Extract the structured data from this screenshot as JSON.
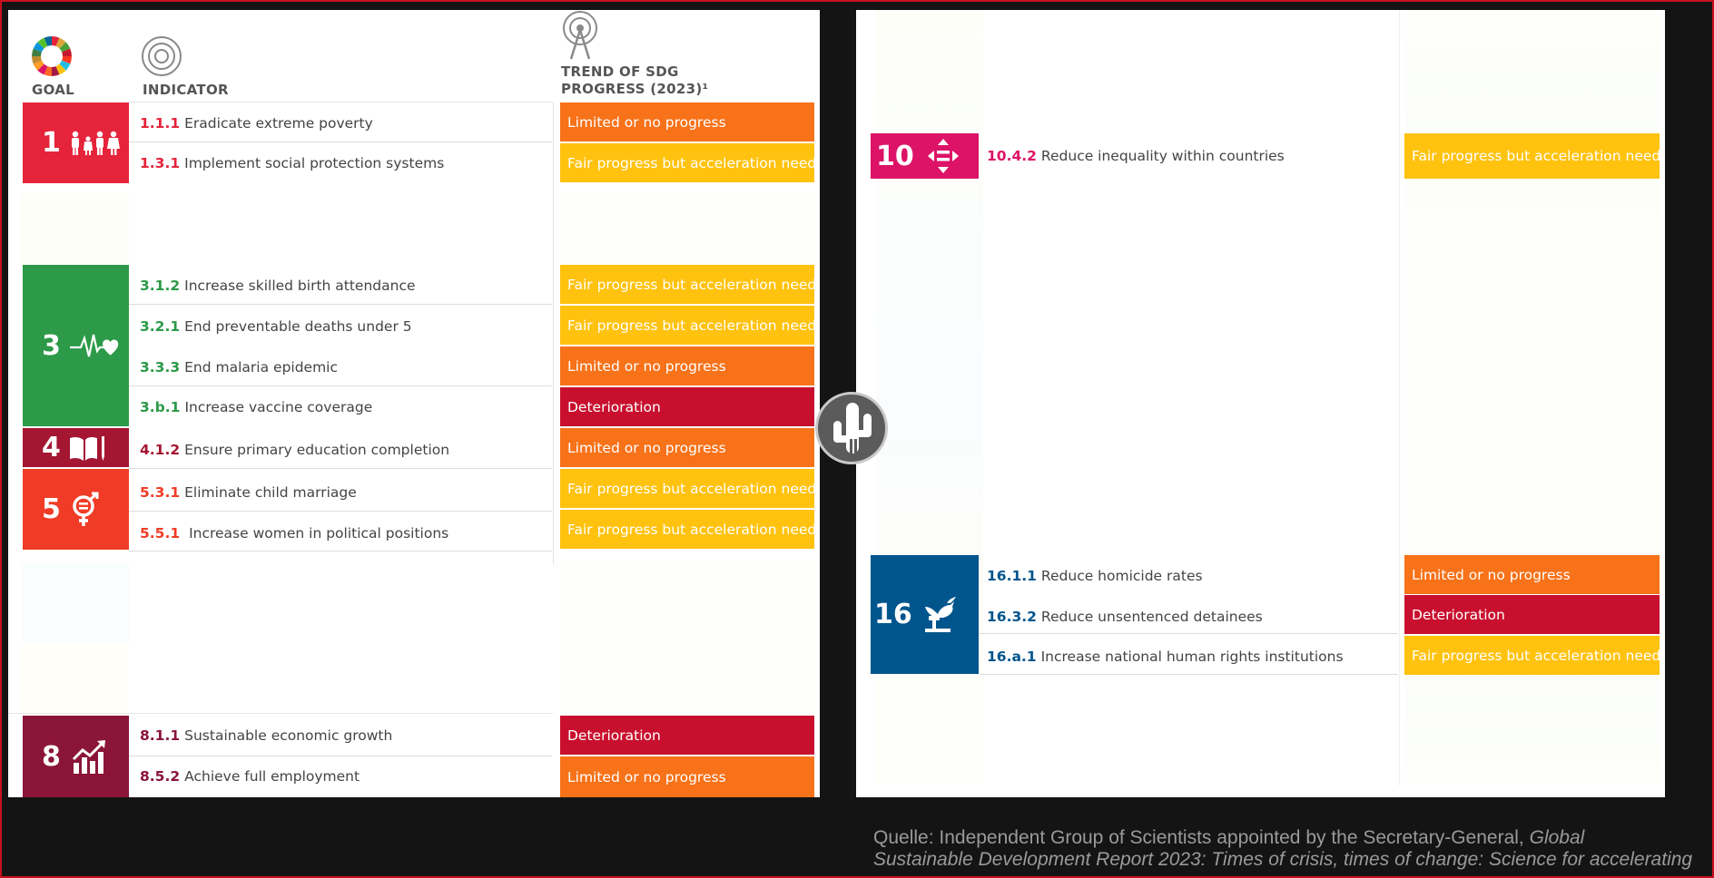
{
  "colors": {
    "deterioration": "#c8102e",
    "limited": "#f77219",
    "fair": "#ffc20e",
    "goal1": "#e5243b",
    "goal3": "#2c9a48",
    "goal4": "#a41632",
    "goal5": "#f03c26",
    "goal8": "#8a1538",
    "goal10": "#dd1367",
    "goal16": "#00558d"
  },
  "header": {
    "goal_label": "GOAL",
    "indicator_label": "INDICATOR",
    "trend_label_line1": "TREND OF SDG",
    "trend_label_line2": "PROGRESS (2023)¹",
    "goal_icon": "sdg-wheel-icon",
    "indicator_icon": "target-icon",
    "trend_icon": "signal-tower-icon"
  },
  "goals": {
    "g1": {
      "number": "1",
      "icon": "family-icon"
    },
    "g3": {
      "number": "3",
      "icon": "heartbeat-icon"
    },
    "g4": {
      "number": "4",
      "icon": "book-pencil-icon"
    },
    "g5": {
      "number": "5",
      "icon": "gender-equality-icon"
    },
    "g8": {
      "number": "8",
      "icon": "growth-chart-icon"
    },
    "g10": {
      "number": "10",
      "icon": "equality-arrows-icon"
    },
    "g16": {
      "number": "16",
      "icon": "dove-gavel-icon"
    }
  },
  "rows": {
    "r111": {
      "code": "1.1.1",
      "text": "Eradicate extreme poverty",
      "status": "Limited or no progress"
    },
    "r131": {
      "code": "1.3.1",
      "text": "Implement social protection systems",
      "status": "Fair progress but acceleration needed"
    },
    "r312": {
      "code": "3.1.2",
      "text": "Increase skilled birth attendance",
      "status": "Fair progress but acceleration needed"
    },
    "r321": {
      "code": "3.2.1",
      "text": "End preventable deaths under 5",
      "status": "Fair progress but acceleration needed"
    },
    "r333": {
      "code": "3.3.3",
      "text": "End malaria epidemic",
      "status": "Limited or no progress"
    },
    "r3b1": {
      "code": "3.b.1",
      "text": "Increase vaccine coverage",
      "status": "Deterioration"
    },
    "r412": {
      "code": "4.1.2",
      "text": "Ensure primary education completion",
      "status": "Limited or no progress"
    },
    "r531": {
      "code": "5.3.1",
      "text": "Eliminate child marriage",
      "status": "Fair progress but acceleration needed"
    },
    "r551": {
      "code": "5.5.1",
      "text": " Increase women in political positions",
      "status": "Fair progress but acceleration needed"
    },
    "r811": {
      "code": "8.1.1",
      "text": "Sustainable economic growth",
      "status": "Deterioration"
    },
    "r852": {
      "code": "8.5.2",
      "text": "Achieve full employment",
      "status": "Limited or no progress"
    },
    "r1042": {
      "code": "10.4.2",
      "text": "Reduce inequality within countries",
      "status": "Fair progress but acceleration needed"
    },
    "r1611": {
      "code": "16.1.1",
      "text": "Reduce homicide rates",
      "status": "Limited or no progress"
    },
    "r1632": {
      "code": "16.3.2",
      "text": "Reduce unsentenced detainees",
      "status": "Deterioration"
    },
    "r16a1": {
      "code": "16.a.1",
      "text": "Increase national human rights institutions",
      "status": "Fair progress but acceleration needed"
    }
  },
  "overlay": {
    "icon": "cactus-logo-icon"
  },
  "source": {
    "prefix": "Quelle:  Independent Group of Scientists appointed by the Secretary-General, ",
    "italic_line1": "Global",
    "italic_line2": "Sustainable Development Report 2023: Times of crisis, times of change: Science for accelerating"
  }
}
